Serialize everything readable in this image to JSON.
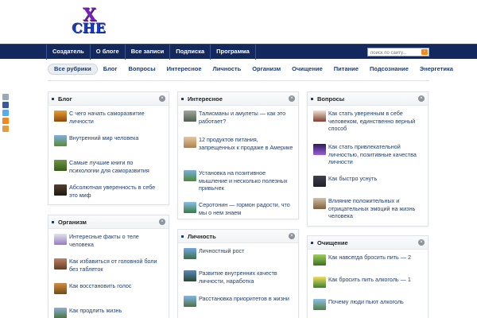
{
  "logo": {
    "top": "X",
    "bottom": "СНЕ"
  },
  "topnav": {
    "items": [
      "Создатель",
      "О блоге",
      "Все записи",
      "Подписка",
      "Программа"
    ],
    "search_placeholder": "поиск по сайту..."
  },
  "categories": {
    "active": "Все рубрики",
    "items": [
      "Блог",
      "Вопросы",
      "Интересное",
      "Личность",
      "Организм",
      "Очищение",
      "Питание",
      "Подсознание",
      "Энергетика"
    ]
  },
  "widgets": {
    "blog": {
      "title": "Блог",
      "items": [
        "С чего начать саморазвитие личности",
        "Внутренний мир человека",
        "Самые лучшие книги по психологии для саморазвития",
        "Абсолютная уверенность в себе это миф"
      ]
    },
    "organism": {
      "title": "Организм",
      "items": [
        "Интересные факты о теле человека",
        "Как избавиться от головной боли без таблеток",
        "Как восстановить голос",
        "Как продлить жизнь"
      ]
    },
    "interesting": {
      "title": "Интересное",
      "items": [
        "Талисманы и амулеты — как это работает?",
        "12 продуктов питания, запрещенных к продаже в Америке",
        "Установка на позитивное мышление и несколько полезных привычек",
        "Серотонин — гормон радости, что мы о нем знаем"
      ]
    },
    "personality": {
      "title": "Личность",
      "items": [
        "Личностный рост",
        "Развитие внутренних качеств личности, наработка",
        "Расстановка приоритетов в жизни"
      ]
    },
    "questions": {
      "title": "Вопросы",
      "items": [
        "Как стать уверенным в себе человеком, единственно верный способ",
        "Как стать привлекательной личностью, позитивные качества личности",
        "Как быстро уснуть",
        "Влияние положительных и отрицательных эмоций на жизнь человека"
      ]
    },
    "cleansing": {
      "title": "Очищение",
      "items": [
        "Как навсегда бросить пить — 2",
        "Как бросить пить алкоголь — 1",
        "Почему люди пьют алкоголь"
      ]
    }
  },
  "colors": {
    "nav_bg": "#13295e",
    "link": "#1e3e6e",
    "accent": "#f08a1c"
  }
}
